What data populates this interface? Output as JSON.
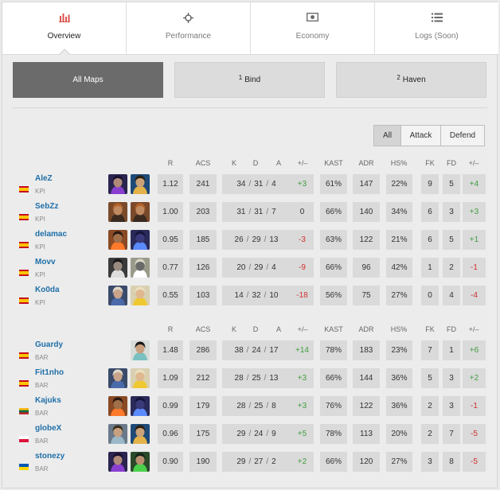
{
  "tabs": [
    {
      "label": "Overview",
      "icon": "bar-chart-icon",
      "active": true
    },
    {
      "label": "Performance",
      "icon": "crosshair-icon",
      "active": false
    },
    {
      "label": "Economy",
      "icon": "money-icon",
      "active": false
    },
    {
      "label": "Logs (Soon)",
      "icon": "list-icon",
      "active": false
    }
  ],
  "maps": [
    {
      "label": "All Maps",
      "num": "",
      "active": true
    },
    {
      "label": "Bind",
      "num": "1",
      "active": false
    },
    {
      "label": "Haven",
      "num": "2",
      "active": false
    }
  ],
  "side_filter": [
    "All",
    "Attack",
    "Defend"
  ],
  "columns": [
    "R",
    "ACS",
    "K",
    "D",
    "A",
    "+/–",
    "KAST",
    "ADR",
    "HS%",
    "FK",
    "FD",
    "+/–"
  ],
  "colors": {
    "accent": "#d9534f",
    "positive": "#3f9e3f",
    "negative": "#d03030",
    "link": "#1f6fa8"
  },
  "teams": [
    {
      "players": [
        {
          "name": "AleZ",
          "team": "KPI",
          "flag": "spain",
          "agents": [
            "reyna",
            "chamber"
          ],
          "r": "1.12",
          "acs": "241",
          "k": "34",
          "d": "31",
          "a": "4",
          "kd": "+3",
          "kast": "61%",
          "adr": "147",
          "hs": "22%",
          "fk": "9",
          "fd": "5",
          "fkfd": "+4"
        },
        {
          "name": "SebZz",
          "team": "KPI",
          "flag": "spain",
          "agents": [
            "breach",
            "breach"
          ],
          "r": "1.00",
          "acs": "203",
          "k": "31",
          "d": "31",
          "a": "7",
          "kd": "0",
          "kast": "66%",
          "adr": "140",
          "hs": "34%",
          "fk": "6",
          "fd": "3",
          "fkfd": "+3"
        },
        {
          "name": "delamac",
          "team": "KPI",
          "flag": "spain",
          "agents": [
            "phoenix",
            "omen"
          ],
          "r": "0.95",
          "acs": "185",
          "k": "26",
          "d": "29",
          "a": "13",
          "kd": "-3",
          "kast": "63%",
          "adr": "122",
          "hs": "21%",
          "fk": "6",
          "fd": "5",
          "fkfd": "+1"
        },
        {
          "name": "Movv",
          "team": "KPI",
          "flag": "spain",
          "agents": [
            "cypher-dark",
            "cypher"
          ],
          "r": "0.77",
          "acs": "126",
          "k": "20",
          "d": "29",
          "a": "4",
          "kd": "-9",
          "kast": "66%",
          "adr": "96",
          "hs": "42%",
          "fk": "1",
          "fd": "2",
          "fkfd": "-1"
        },
        {
          "name": "Ko0da",
          "team": "KPI",
          "flag": "spain",
          "agents": [
            "sova",
            "killjoy"
          ],
          "r": "0.55",
          "acs": "103",
          "k": "14",
          "d": "32",
          "a": "10",
          "kd": "-18",
          "kast": "56%",
          "adr": "75",
          "hs": "27%",
          "fk": "0",
          "fd": "4",
          "fkfd": "-4"
        }
      ]
    },
    {
      "players": [
        {
          "name": "Guardy",
          "team": "BAR",
          "flag": "spain",
          "agents": [
            "sage"
          ],
          "r": "1.48",
          "acs": "286",
          "k": "38",
          "d": "24",
          "a": "17",
          "kd": "+14",
          "kast": "78%",
          "adr": "183",
          "hs": "23%",
          "fk": "7",
          "fd": "1",
          "fkfd": "+6"
        },
        {
          "name": "Fit1nho",
          "team": "BAR",
          "flag": "spain",
          "agents": [
            "sova",
            "killjoy"
          ],
          "r": "1.09",
          "acs": "212",
          "k": "28",
          "d": "25",
          "a": "13",
          "kd": "+3",
          "kast": "66%",
          "adr": "144",
          "hs": "36%",
          "fk": "5",
          "fd": "3",
          "fkfd": "+2"
        },
        {
          "name": "Kajuks",
          "team": "BAR",
          "flag": "lithuania",
          "agents": [
            "phoenix",
            "omen"
          ],
          "r": "0.99",
          "acs": "179",
          "k": "28",
          "d": "25",
          "a": "8",
          "kd": "+3",
          "kast": "76%",
          "adr": "122",
          "hs": "36%",
          "fk": "2",
          "fd": "3",
          "fkfd": "-1"
        },
        {
          "name": "globeX",
          "team": "BAR",
          "flag": "poland",
          "agents": [
            "sage-b",
            "chamber"
          ],
          "r": "0.96",
          "acs": "175",
          "k": "29",
          "d": "24",
          "a": "9",
          "kd": "+5",
          "kast": "78%",
          "adr": "113",
          "hs": "20%",
          "fk": "2",
          "fd": "7",
          "fkfd": "-5"
        },
        {
          "name": "stonezy",
          "team": "BAR",
          "flag": "ukraine",
          "agents": [
            "reyna",
            "viper"
          ],
          "r": "0.90",
          "acs": "190",
          "k": "29",
          "d": "27",
          "a": "2",
          "kd": "+2",
          "kast": "66%",
          "adr": "120",
          "hs": "27%",
          "fk": "3",
          "fd": "8",
          "fkfd": "-5"
        }
      ]
    }
  ]
}
